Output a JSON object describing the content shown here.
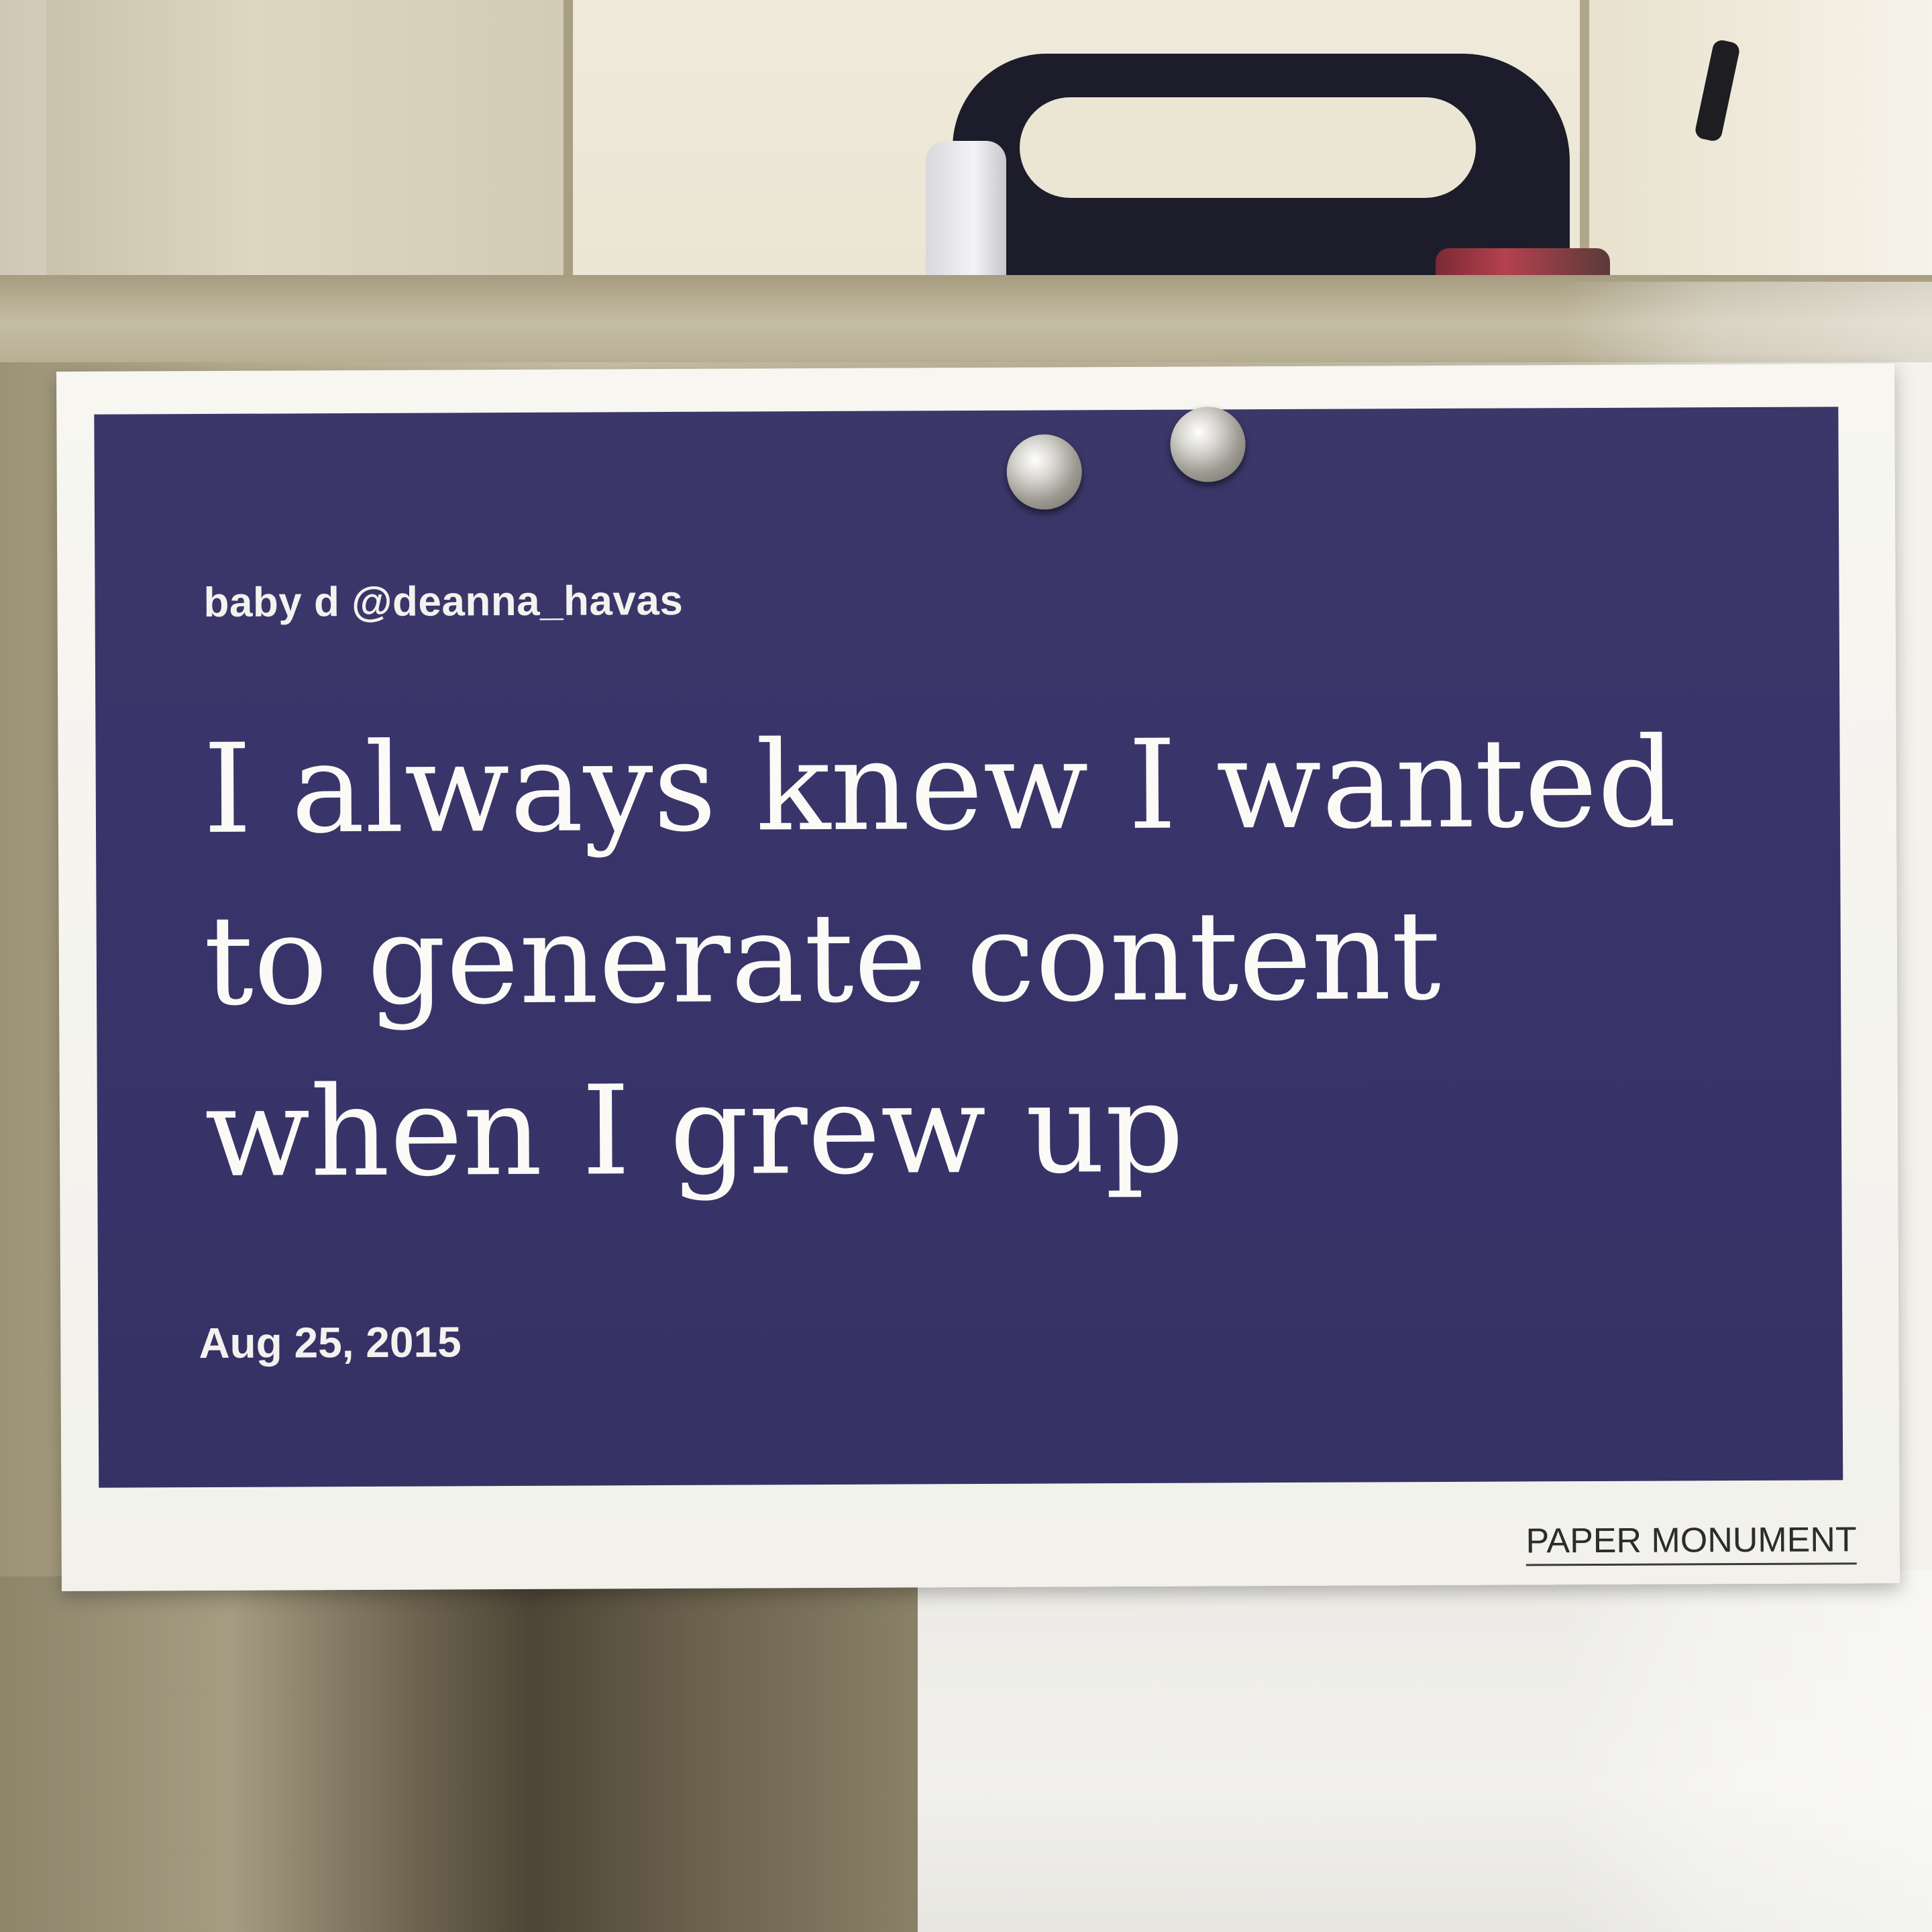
{
  "card": {
    "handle": "baby d @deanna_havas",
    "quote_lines": [
      "I always knew I wanted",
      "to generate content",
      "when I grew up"
    ],
    "date": "Aug 25, 2015",
    "brand": "PAPER MONUMENT"
  },
  "colors": {
    "panel": "#38346a",
    "card_border": "#f4f3ee",
    "text": "#fbfaf6"
  }
}
